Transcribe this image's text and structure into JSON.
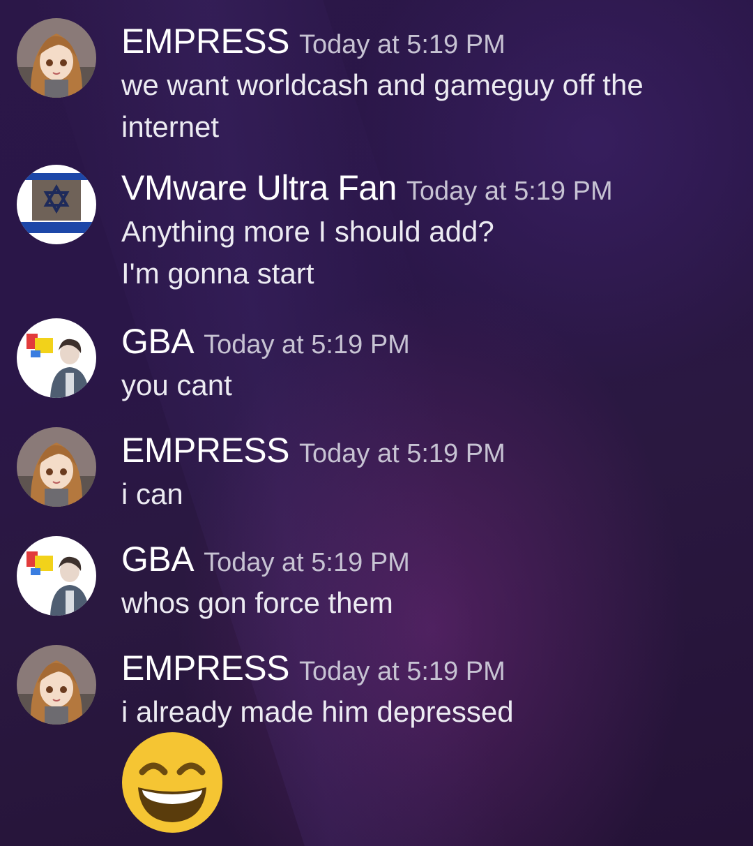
{
  "messages": [
    {
      "author": "EMPRESS",
      "timestamp": "Today at 5:19 PM",
      "lines": [
        "we want worldcash and gameguy off the",
        "internet"
      ],
      "avatar_icon": "anime-girl-avatar-icon"
    },
    {
      "author": "VMware Ultra Fan",
      "timestamp": "Today at 5:19 PM",
      "lines": [
        "Anything more I should add?",
        "I'm gonna start"
      ],
      "avatar_icon": "flag-star-avatar-icon"
    },
    {
      "author": "GBA",
      "timestamp": "Today at 5:19 PM",
      "lines": [
        "you cant"
      ],
      "avatar_icon": "person-avatar-icon"
    },
    {
      "author": "EMPRESS",
      "timestamp": "Today at 5:19 PM",
      "lines": [
        "i can"
      ],
      "avatar_icon": "anime-girl-avatar-icon"
    },
    {
      "author": "GBA",
      "timestamp": "Today at 5:19 PM",
      "lines": [
        "whos gon force them"
      ],
      "avatar_icon": "person-avatar-icon"
    },
    {
      "author": "EMPRESS",
      "timestamp": "Today at 5:19 PM",
      "lines": [
        "i already made him depressed"
      ],
      "avatar_icon": "anime-girl-avatar-icon",
      "emoji_icon": "grinning-smiling-eyes-emoji-icon"
    }
  ],
  "colors": {
    "background": "#2a1648",
    "author": "#ffffff",
    "timestamp": "#c7c3d3",
    "text": "#ecebf2",
    "emoji_face": "#f5c533"
  }
}
